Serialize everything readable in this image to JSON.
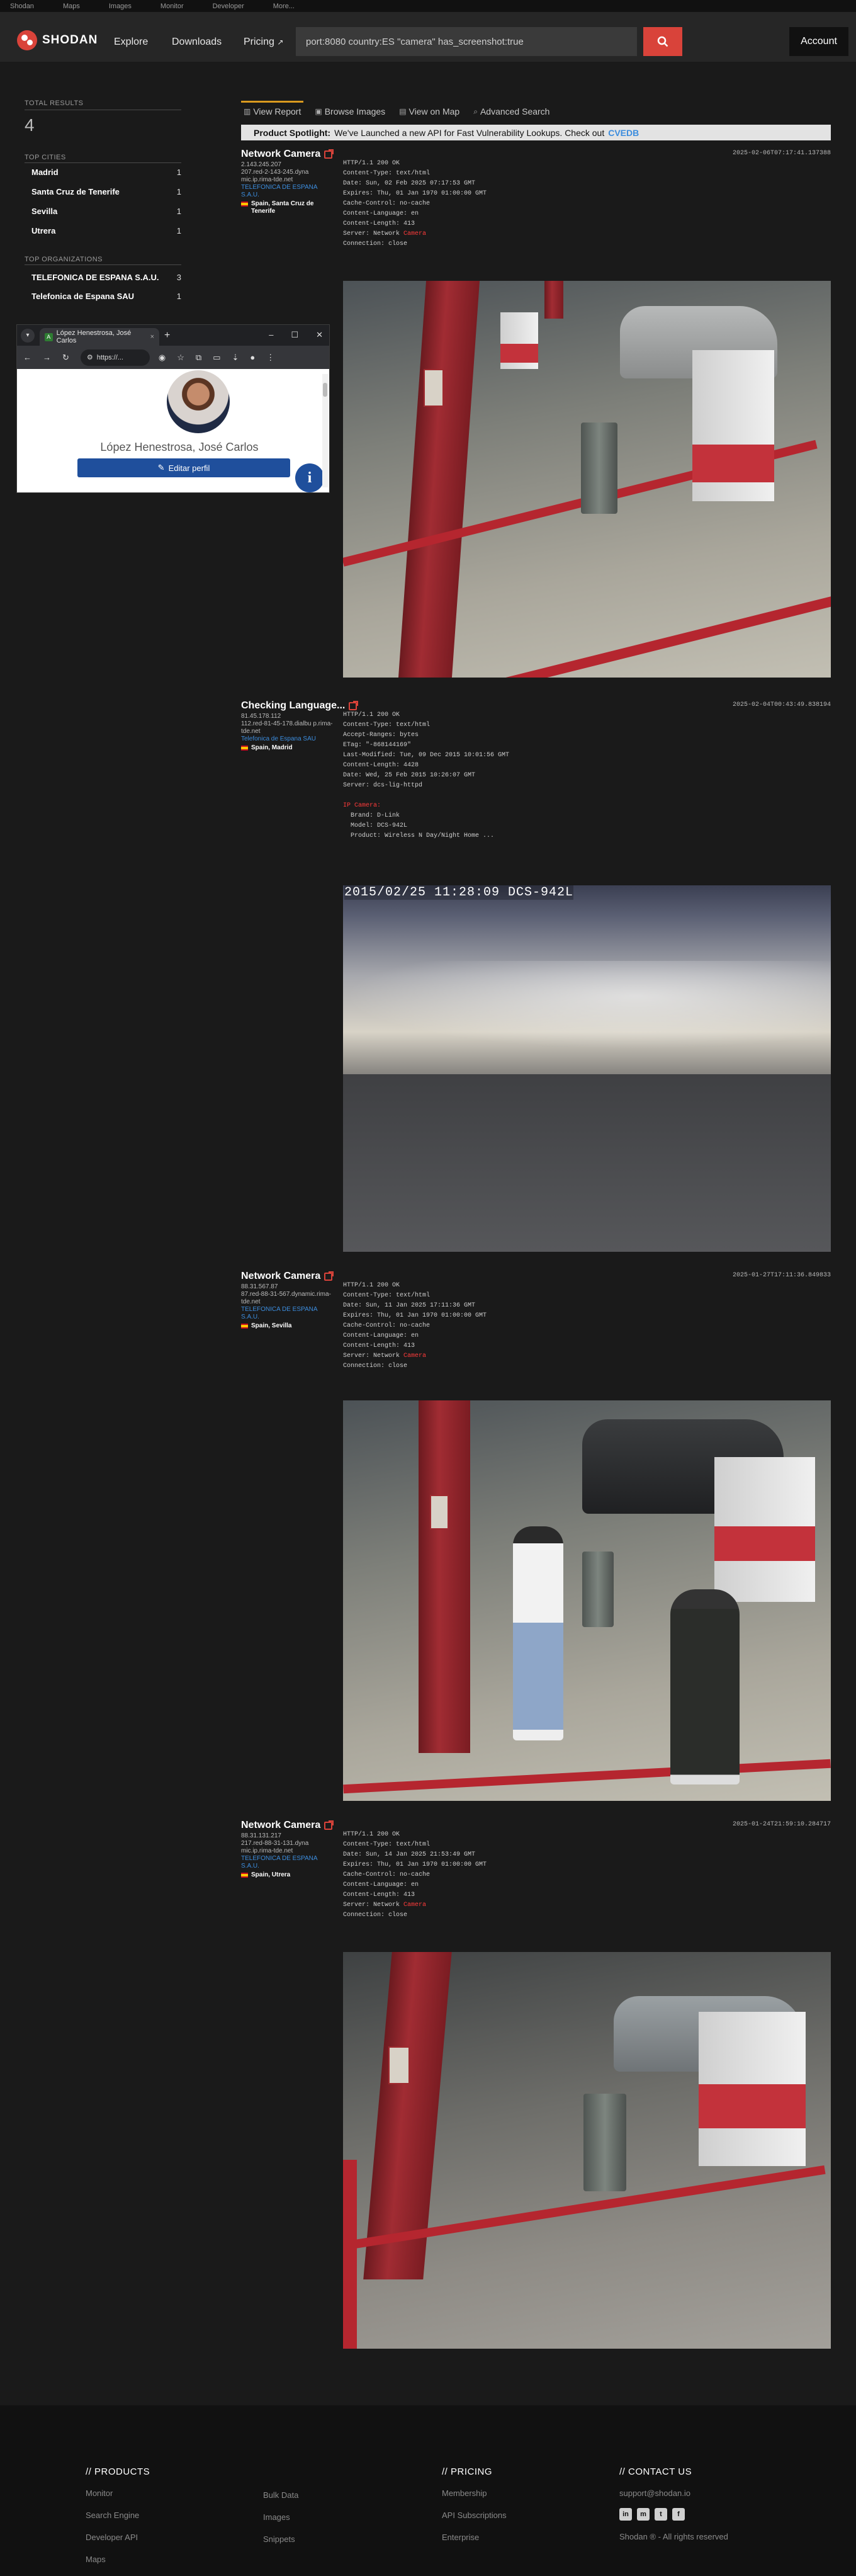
{
  "topbar": {
    "links": [
      "Shodan",
      "Maps",
      "Images",
      "Monitor",
      "Developer",
      "More..."
    ]
  },
  "nav": {
    "brand": "SHODAN",
    "links": [
      "Explore",
      "Downloads",
      "Pricing"
    ],
    "search_value": "port:8080 country:ES \"camera\" has_screenshot:true",
    "account_label": "Account"
  },
  "sidebar": {
    "total_label": "TOTAL RESULTS",
    "total_value": "4",
    "cities_label": "TOP CITIES",
    "cities": [
      {
        "name": "Madrid",
        "count": "1"
      },
      {
        "name": "Santa Cruz de Tenerife",
        "count": "1"
      },
      {
        "name": "Sevilla",
        "count": "1"
      },
      {
        "name": "Utrera",
        "count": "1"
      }
    ],
    "orgs_label": "TOP ORGANIZATIONS",
    "orgs": [
      {
        "name": "TELEFONICA DE ESPANA S.A.U.",
        "count": "3"
      },
      {
        "name": "Telefonica de Espana SAU",
        "count": "1"
      }
    ]
  },
  "tabs": [
    "View Report",
    "Browse Images",
    "View on Map",
    "Advanced Search"
  ],
  "spotlight": {
    "label": "Product Spotlight:",
    "text": "We've Launched a new API for Fast Vulnerability Lookups. Check out",
    "link": "CVEDB"
  },
  "results": [
    {
      "title": "Network Camera",
      "timestamp": "2025-02-06T07:17:41.137388",
      "ip": "2.143.245.207",
      "hostname": "207.red-2-143-245.dyna mic.ip.rima-tde.net",
      "org": "TELEFONICA DE ESPANA S.A.U.",
      "location": "Spain, Santa Cruz de Tenerife",
      "banner": [
        "HTTP/1.1 200 OK",
        "Content-Type: text/html",
        "Date: Sun, 02 Feb 2025 07:17:53 GMT",
        "Expires: Thu, 01 Jan 1970 01:00:00 GMT",
        "Cache-Control: no-cache",
        "Content-Language: en",
        "Content-Length: 413"
      ],
      "banner_server_prefix": "Server: Network ",
      "banner_server_hl": "Camera",
      "banner_tail": [
        "Connection: close"
      ]
    },
    {
      "title": "Checking Language...",
      "timestamp": "2025-02-04T00:43:49.838194",
      "ip": "81.45.178.112",
      "hostname": "112.red-81-45-178.dialbu p.rima-tde.net",
      "org": "Telefonica de Espana SAU",
      "location": "Spain, Madrid",
      "banner": [
        "HTTP/1.1 200 OK",
        "Content-Type: text/html",
        "Accept-Ranges: bytes",
        "ETag: \"-868144169\"",
        "Last-Modified: Tue, 09 Dec 2015 10:01:56 GMT",
        "Content-Length: 4428",
        "Date: Wed, 25 Feb 2015 10:26:07 GMT",
        "Server: dcs-lig-httpd"
      ],
      "camera_label": "IP Camera:",
      "camera_details": [
        "Brand: D-Link",
        "Model: DCS-942L",
        "Product: Wireless N Day/Night Home ..."
      ],
      "stamp": "2015/02/25 11:28:09 DCS-942L"
    },
    {
      "title": "Network Camera",
      "timestamp": "2025-01-27T17:11:36.849833",
      "ip": "88.31.567.87",
      "hostname": "87.red-88-31-567.dynamic.rima-tde.net",
      "org": "TELEFONICA DE ESPANA S.A.U.",
      "location": "Spain, Sevilla",
      "banner": [
        "HTTP/1.1 200 OK",
        "Content-Type: text/html",
        "Date: Sun, 11 Jan 2025 17:11:36 GMT",
        "Expires: Thu, 01 Jan 1970 01:00:00 GMT",
        "Cache-Control: no-cache",
        "Content-Language: en",
        "Content-Length: 413"
      ],
      "banner_server_prefix": "Server: Network ",
      "banner_server_hl": "Camera",
      "banner_tail": [
        "Connection: close"
      ]
    },
    {
      "title": "Network Camera",
      "timestamp": "2025-01-24T21:59:10.284717",
      "ip": "88.31.131.217",
      "hostname": "217.red-88-31-131.dyna mic.ip.rima-tde.net",
      "org": "TELEFONICA DE ESPANA S.A.U.",
      "location": "Spain, Utrera",
      "banner": [
        "HTTP/1.1 200 OK",
        "Content-Type: text/html",
        "Date: Sun, 14 Jan 2025 21:53:49 GMT",
        "Expires: Thu, 01 Jan 1970 01:00:00 GMT",
        "Cache-Control: no-cache",
        "Content-Language: en",
        "Content-Length: 413"
      ],
      "banner_server_prefix": "Server: Network ",
      "banner_server_hl": "Camera",
      "banner_tail": [
        "Connection: close"
      ]
    }
  ],
  "popup": {
    "tab_title": "López Henestrosa, José Carlos",
    "url": "https://...",
    "person_name": "López Henestrosa, José Carlos",
    "edit_label": "Editar perfil"
  },
  "footer": {
    "products_title": "// PRODUCTS",
    "products_col1": [
      "Monitor",
      "Search Engine",
      "Developer API",
      "Maps"
    ],
    "products_col2": [
      "Bulk Data",
      "Images",
      "Snippets"
    ],
    "pricing_title": "// PRICING",
    "pricing": [
      "Membership",
      "API Subscriptions",
      "Enterprise"
    ],
    "contact_title": "// CONTACT US",
    "email": "support@shodan.io",
    "social": [
      "in",
      "m",
      "t",
      "f"
    ],
    "copyright": "Shodan ® - All rights reserved"
  }
}
